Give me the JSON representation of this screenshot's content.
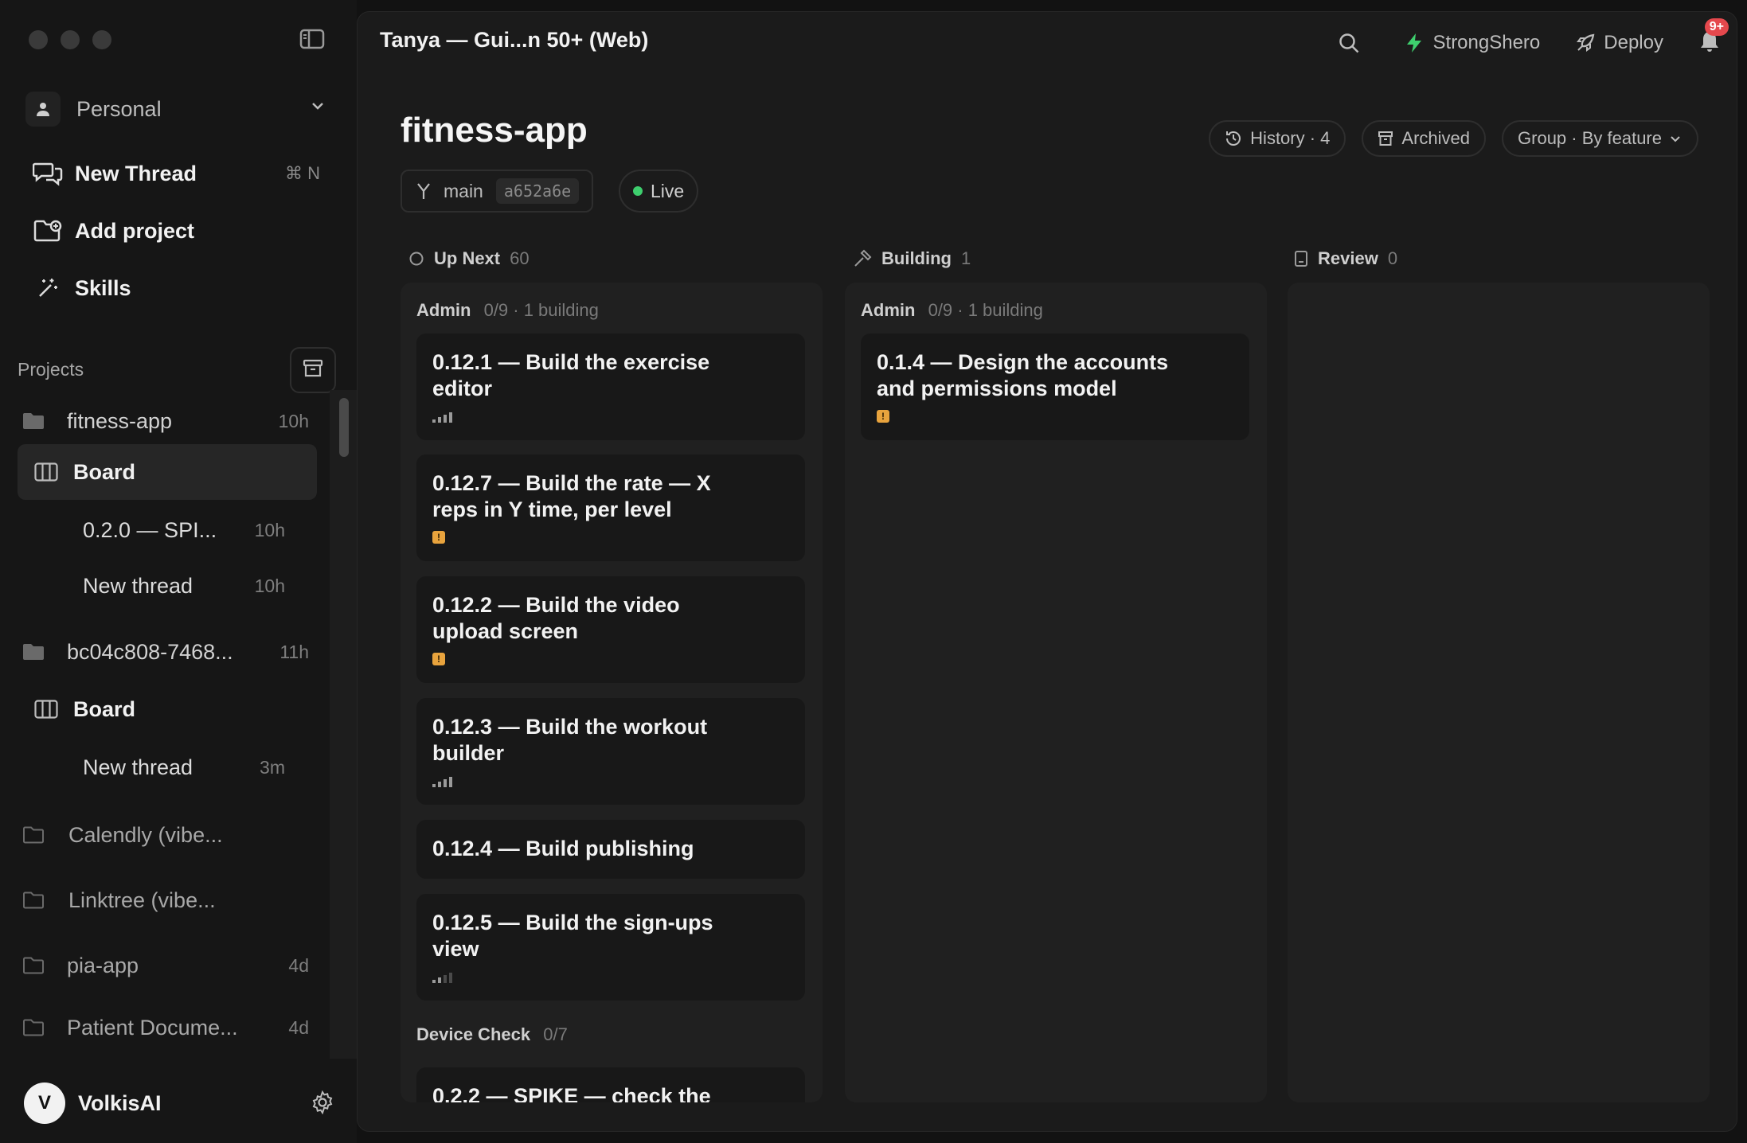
{
  "sidebar": {
    "workspace": "Personal",
    "nav": [
      {
        "label": "New Thread",
        "shortcut": "⌘ N"
      },
      {
        "label": "Add project"
      },
      {
        "label": "Skills"
      }
    ],
    "projects_title": "Projects",
    "projects": [
      {
        "label": "fitness-app",
        "time": "10h"
      },
      {
        "label": "Board"
      },
      {
        "label": "0.2.0 — SPI...",
        "time": "10h"
      },
      {
        "label": "New thread",
        "time": "10h"
      },
      {
        "label": "bc04c808-7468...",
        "time": "11h"
      },
      {
        "label": "Board"
      },
      {
        "label": "New thread",
        "time": "3m"
      },
      {
        "label": "Calendly (vibe..."
      },
      {
        "label": "Linktree (vibe..."
      },
      {
        "label": "pia-app",
        "time": "4d"
      },
      {
        "label": "Patient Docume...",
        "time": "4d"
      }
    ],
    "user": {
      "initial": "V",
      "name": "VolkisAI"
    }
  },
  "topbar": {
    "title": "Tanya — Gui...n 50+ (Web)",
    "account": "StrongShero",
    "deploy": "Deploy",
    "notifications": "9+"
  },
  "page": {
    "title": "fitness-app",
    "branch": "main",
    "commit": "a652a6e",
    "status": "Live",
    "history": "History · 4",
    "archived": "Archived",
    "group": "Group · By feature"
  },
  "columns": [
    {
      "name": "Up Next",
      "count": "60",
      "groups": [
        {
          "name": "Admin",
          "meta": "0/9 · 1 building"
        },
        {
          "name": "Device Check",
          "meta": "0/7"
        }
      ],
      "cards": [
        {
          "title": "0.12.1 — Build the exercise editor",
          "mark": "bars-3"
        },
        {
          "title": "0.12.7 — Build the rate — X reps in Y time, per level",
          "mark": "warn"
        },
        {
          "title": "0.12.2 — Build the video upload screen",
          "mark": "warn"
        },
        {
          "title": "0.12.3 — Build the workout builder",
          "mark": "bars-3"
        },
        {
          "title": "0.12.4 — Build publishing",
          "mark": "none"
        },
        {
          "title": "0.12.5 — Build the sign-ups view",
          "mark": "bars-2"
        },
        {
          "title": "0.2.2 — SPIKE — check the",
          "mark": "none"
        }
      ]
    },
    {
      "name": "Building",
      "count": "1",
      "groups": [
        {
          "name": "Admin",
          "meta": "0/9 · 1 building"
        }
      ],
      "cards": [
        {
          "title": "0.1.4 — Design the accounts and permissions model",
          "mark": "warn"
        }
      ]
    },
    {
      "name": "Review",
      "count": "0",
      "groups": [],
      "cards": []
    }
  ],
  "colors": {
    "accent_green": "#3ecf6e",
    "warning": "#e8a33d",
    "badge": "#e5484d"
  }
}
